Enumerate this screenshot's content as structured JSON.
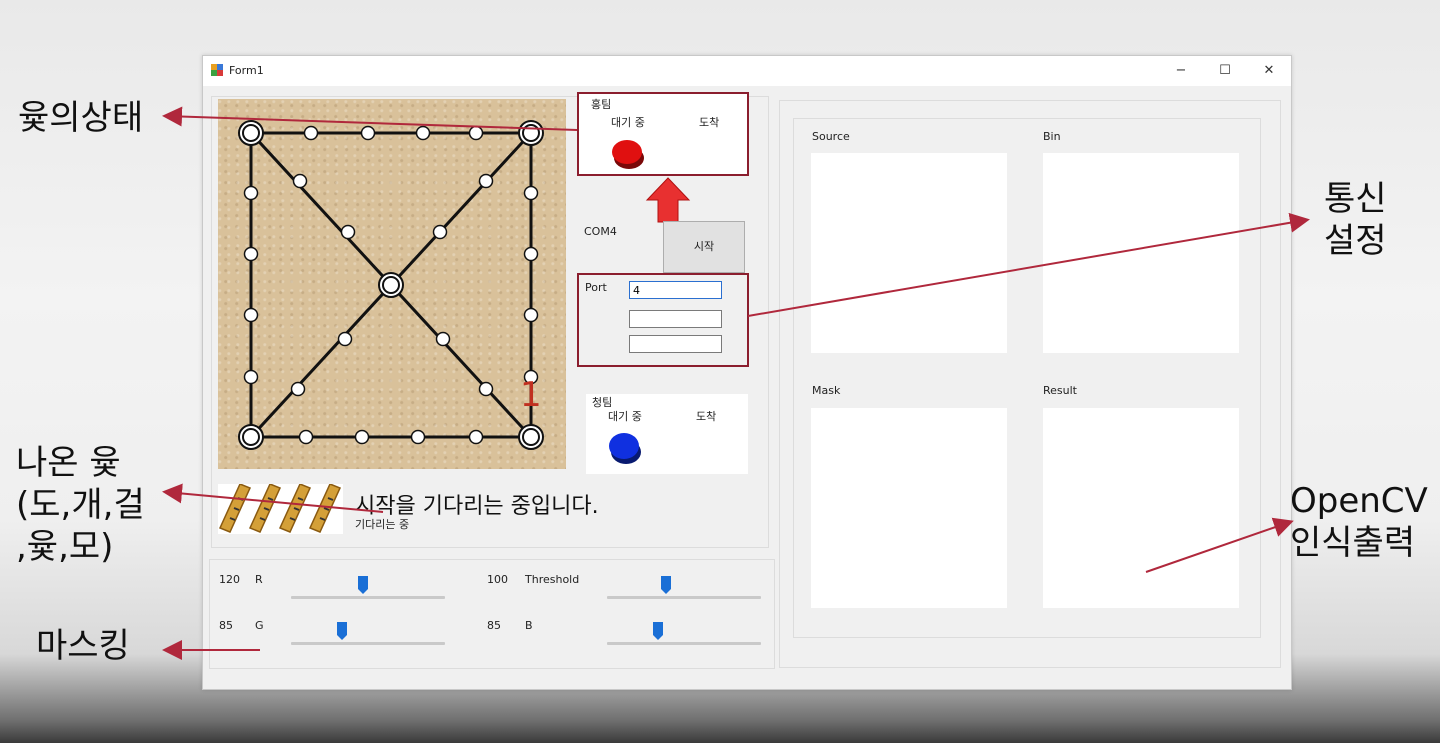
{
  "annotations": {
    "yut_state": "윷의상태",
    "comm_setup_line1": "통신",
    "comm_setup_line2": "설정",
    "result_yut_line1": "나온 윷",
    "result_yut_line2": "(도,개,걸",
    "result_yut_line3": ",윷,모)",
    "masking": "마스킹",
    "opencv_line1": "OpenCV",
    "opencv_line2": "인식출력"
  },
  "window": {
    "title": "Form1",
    "minimize": "−",
    "maximize": "☐",
    "close": "✕"
  },
  "red_team": {
    "title": "홍팀",
    "waiting": "대기 중",
    "arrived": "도착",
    "color": "#e01010"
  },
  "blue_team": {
    "title": "청팀",
    "waiting": "대기 중",
    "arrived": "도착",
    "color": "#1030e0"
  },
  "comm": {
    "com_port_label": "COM4",
    "start_button": "시작",
    "port_label": "Port",
    "port_value": "4",
    "field2_value": "",
    "field3_value": ""
  },
  "board": {
    "counter": "1"
  },
  "status": {
    "main_message": "시작을 기다리는 중입니다.",
    "sub_message": "기다리는 중"
  },
  "sliders": {
    "r": {
      "value": "120",
      "label": "R",
      "level": 0.47
    },
    "g": {
      "value": "85",
      "label": "G",
      "level": 0.33
    },
    "threshold": {
      "value": "100",
      "label": "Threshold",
      "level": 0.4
    },
    "b": {
      "value": "85",
      "label": "B",
      "level": 0.33
    }
  },
  "opencv": {
    "source_label": "Source",
    "bin_label": "Bin",
    "mask_label": "Mask",
    "result_label": "Result"
  },
  "colors": {
    "annotation_arrow": "#b0283c",
    "highlight_box": "#8b1e2e",
    "slider_thumb": "#1a6fd6"
  }
}
